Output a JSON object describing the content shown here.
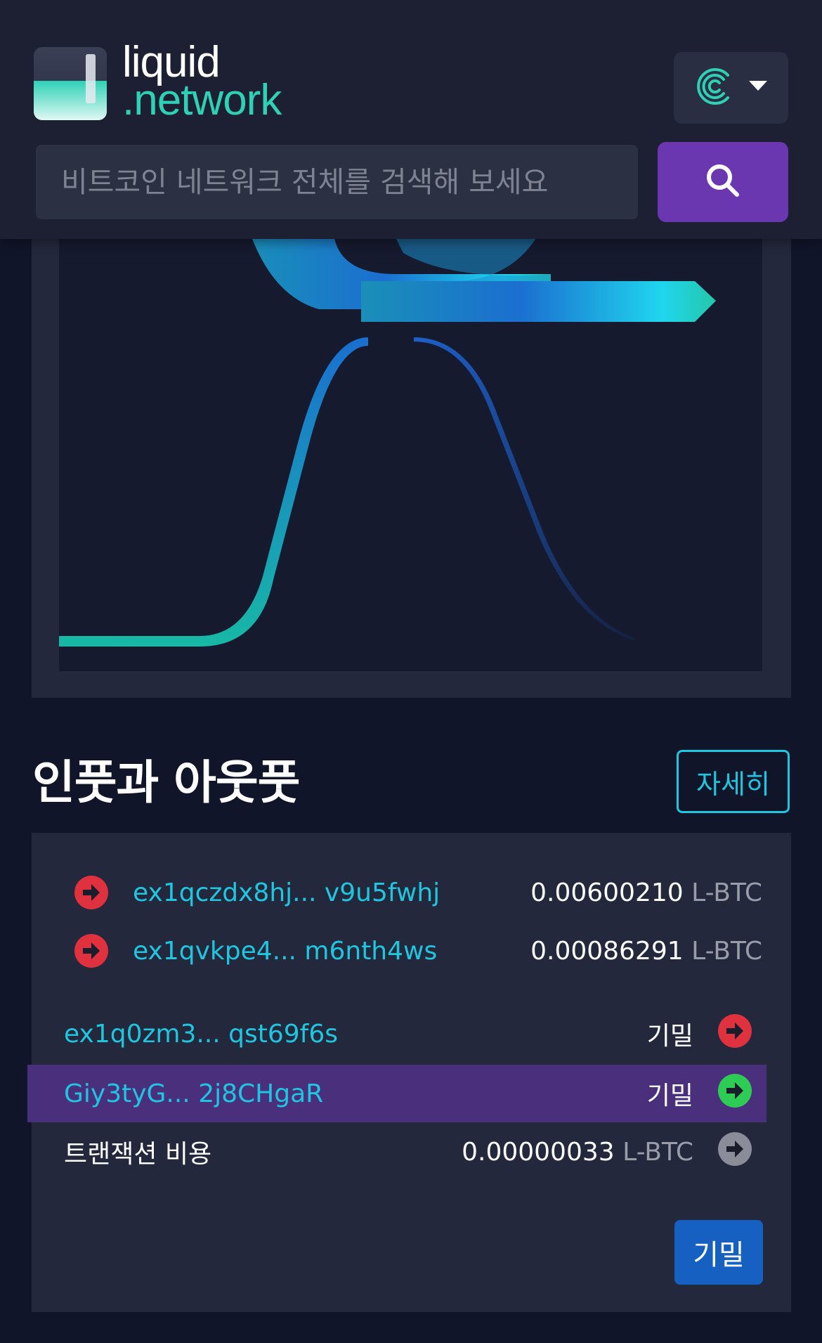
{
  "brand": {
    "name_line1": "liquid",
    "name_line2": ".network",
    "accent": "#2fd1b6"
  },
  "header": {
    "network_icon": "liquid-network-icon",
    "dropdown_icon": "caret-down-icon",
    "search_placeholder": "비트코인 네트워크 전체를 검색해 보세요",
    "search_icon": "search-icon",
    "search_button_color": "#6b37b0"
  },
  "io_section": {
    "title": "인풋과 아웃풋",
    "details_label": "자세히",
    "inputs": [
      {
        "address": "ex1qczdx8hj... v9u5fwhj",
        "amount": "0.00600210",
        "unit": "L-BTC",
        "icon": "red-arrow-right-icon"
      },
      {
        "address": "ex1qvkpe4... m6nth4ws",
        "amount": "0.00086291",
        "unit": "L-BTC",
        "icon": "red-arrow-right-icon"
      }
    ],
    "outputs": [
      {
        "address": "ex1q0zm3... qst69f6s",
        "value": "기밀",
        "icon": "red-arrow-right-icon"
      },
      {
        "address": "Giy3tyG...  2j8CHgaR",
        "value": "기밀",
        "icon": "green-arrow-right-icon",
        "highlighted": true
      }
    ],
    "fee": {
      "label": "트랜잭션 비용",
      "amount": "0.00000033",
      "unit": "L-BTC",
      "icon": "gray-arrow-right-icon"
    },
    "confidential_label": "기밀"
  }
}
